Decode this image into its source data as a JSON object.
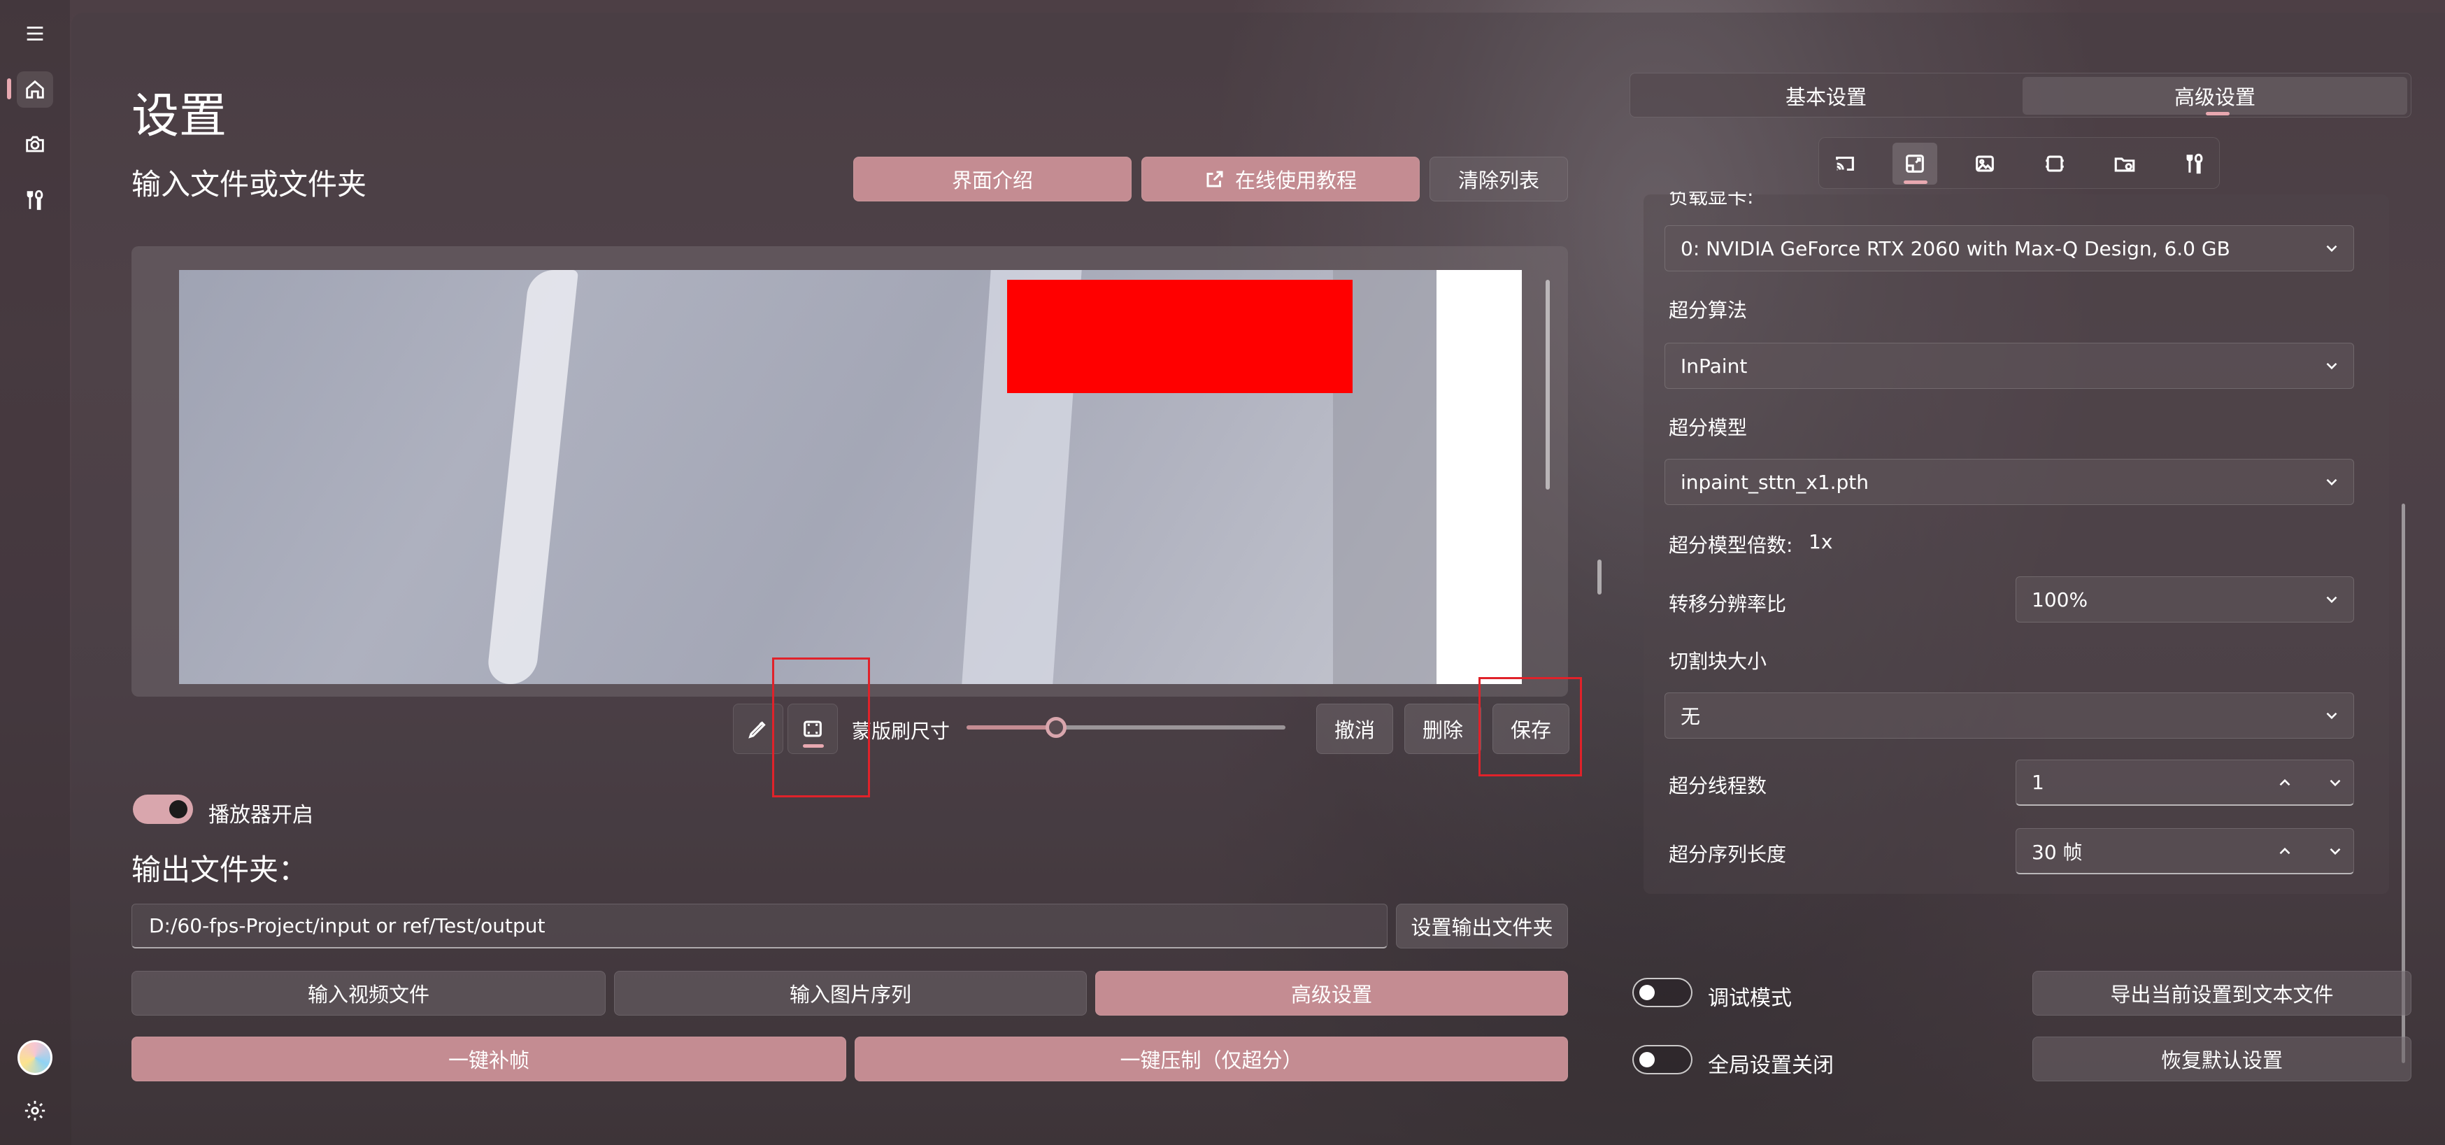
{
  "page": {
    "title": "设置",
    "input_section_title": "输入文件或文件夹",
    "output_section_title": "输出文件夹："
  },
  "header_buttons": {
    "intro": "界面介绍",
    "tutorial": "在线使用教程",
    "clear_list": "清除列表"
  },
  "mask_tools": {
    "brush_size_label": "蒙版刷尺寸",
    "brush_size_value": 0.28,
    "undo": "撤消",
    "delete": "删除",
    "save": "保存"
  },
  "player_toggle": {
    "label": "播放器开启",
    "on": true
  },
  "output": {
    "path": "D:/60-fps-Project/input or ref/Test/output",
    "set_button": "设置输出文件夹"
  },
  "mode_buttons": {
    "video": "输入视频文件",
    "images": "输入图片序列",
    "advanced": "高级设置"
  },
  "action_buttons": {
    "interpolate": "一键补帧",
    "compress": "一键压制（仅超分）"
  },
  "right_panel": {
    "tabs": [
      "基本设置",
      "高级设置"
    ],
    "selected_tab": "高级设置",
    "icon_tabs": [
      "cast-icon",
      "resize-icon",
      "image-settings-icon",
      "frame-icon",
      "folder-settings-icon",
      "tools-icon"
    ],
    "selected_icon_tab": "resize-icon",
    "gpu_label_partial": "负载显卡:",
    "gpu_value": "0: NVIDIA GeForce RTX 2060 with Max-Q Design, 6.0 GB",
    "algorithm_label": "超分算法",
    "algorithm_value": "InPaint",
    "model_label": "超分模型",
    "model_value": "inpaint_sttn_x1.pth",
    "scale_label": "超分模型倍数:",
    "scale_value": "1x",
    "transfer_ratio_label": "转移分辨率比",
    "transfer_ratio_value": "100%",
    "tile_size_label": "切割块大小",
    "tile_size_value": "无",
    "threads_label": "超分线程数",
    "threads_value": "1",
    "sequence_length_label": "超分序列长度",
    "sequence_length_value": "30 帧"
  },
  "bottom_right": {
    "debug_label": "调试模式",
    "debug_on": false,
    "global_close_label": "全局设置关闭",
    "global_close_on": false,
    "export_button": "导出当前设置到文本文件",
    "restore_button": "恢复默认设置"
  },
  "colors": {
    "accent": "#c48c92",
    "mask_red": "#ff0000",
    "highlight_red": "#e0222a",
    "indicator_pink": "#e8a8b0"
  }
}
